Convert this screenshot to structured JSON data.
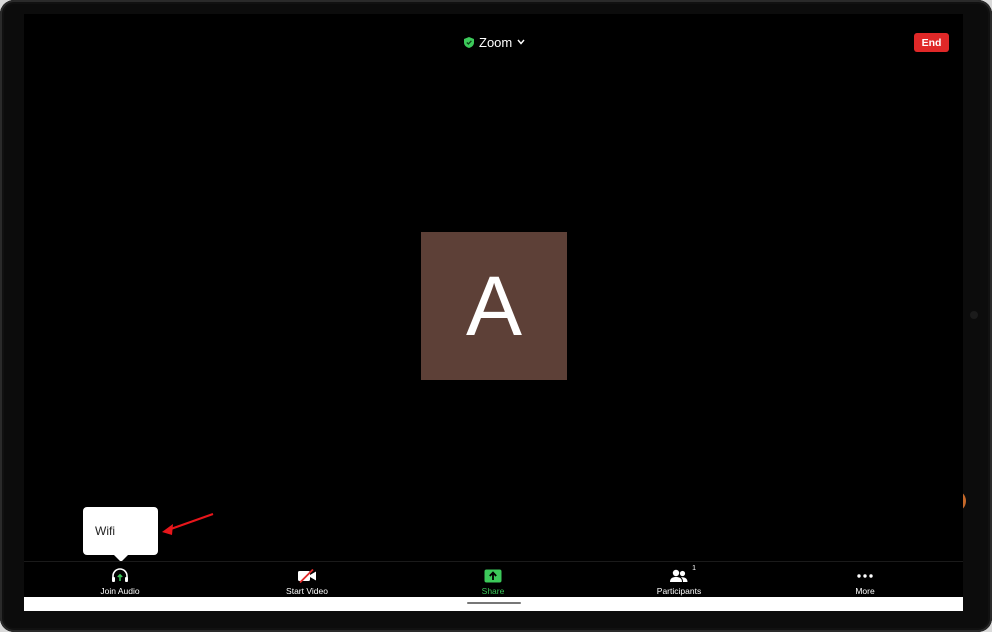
{
  "header": {
    "title": "Zoom",
    "end_label": "End"
  },
  "participant": {
    "initial": "A"
  },
  "toolbar": {
    "items": [
      {
        "label": "Join Audio",
        "icon": "headphones-icon"
      },
      {
        "label": "Start Video",
        "icon": "video-off-icon"
      },
      {
        "label": "Share",
        "icon": "share-screen-icon"
      },
      {
        "label": "Participants",
        "icon": "participants-icon",
        "count": "1"
      },
      {
        "label": "More",
        "icon": "more-icon"
      }
    ]
  },
  "tooltip": {
    "text": "Wifi"
  },
  "colors": {
    "end": "#e02828",
    "share": "#3cc95a",
    "avatar_bg": "#5d4037",
    "shield": "#3cc95a",
    "annotation": "#e8161b"
  }
}
